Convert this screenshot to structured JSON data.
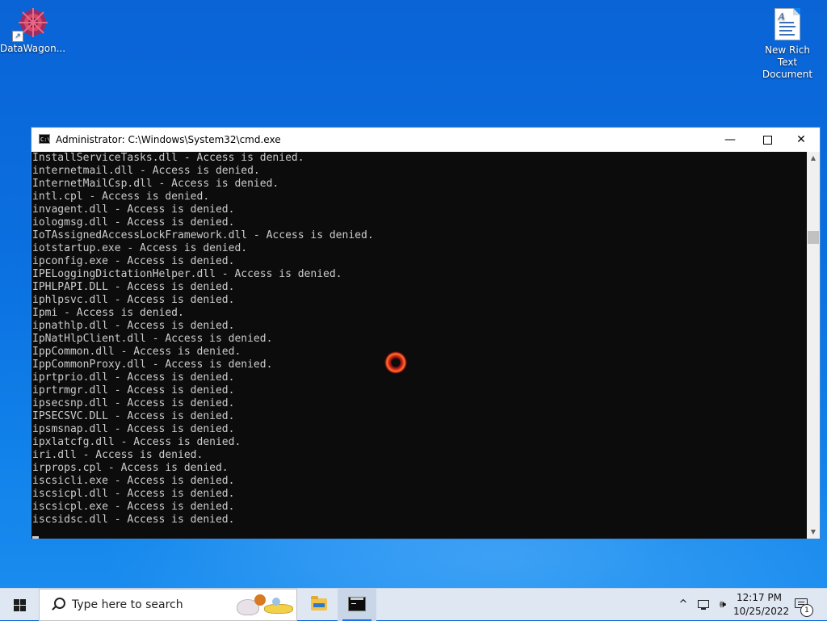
{
  "desktop": {
    "icons": [
      {
        "label": "DataWagon...",
        "icon": "datawagon-app-icon"
      },
      {
        "label": "New Rich Text Document",
        "icon": "rich-text-document-icon"
      }
    ]
  },
  "window": {
    "title": "Administrator:  C:\\Windows\\System32\\cmd.exe",
    "icon": "cmd-icon",
    "controls": {
      "minimize": "—",
      "close": "✕"
    },
    "lines": [
      "InstallServiceTasks.dll - Access is denied.",
      "internetmail.dll - Access is denied.",
      "InternetMailCsp.dll - Access is denied.",
      "intl.cpl - Access is denied.",
      "invagent.dll - Access is denied.",
      "iologmsg.dll - Access is denied.",
      "IoTAssignedAccessLockFramework.dll - Access is denied.",
      "iotstartup.exe - Access is denied.",
      "ipconfig.exe - Access is denied.",
      "IPELoggingDictationHelper.dll - Access is denied.",
      "IPHLPAPI.DLL - Access is denied.",
      "iphlpsvc.dll - Access is denied.",
      "Ipmi - Access is denied.",
      "ipnathlp.dll - Access is denied.",
      "IpNatHlpClient.dll - Access is denied.",
      "IppCommon.dll - Access is denied.",
      "IppCommonProxy.dll - Access is denied.",
      "iprtprio.dll - Access is denied.",
      "iprtrmgr.dll - Access is denied.",
      "ipsecsnp.dll - Access is denied.",
      "IPSECSVC.DLL - Access is denied.",
      "ipsmsnap.dll - Access is denied.",
      "ipxlatcfg.dll - Access is denied.",
      "iri.dll - Access is denied.",
      "irprops.cpl - Access is denied.",
      "iscsicli.exe - Access is denied.",
      "iscsicpl.dll - Access is denied.",
      "iscsicpl.exe - Access is denied.",
      "iscsidsc.dll - Access is denied."
    ]
  },
  "taskbar": {
    "search_placeholder": "Type here to search",
    "chevron": "^",
    "volume": "🕪",
    "time": "12:17 PM",
    "date": "10/25/2022",
    "notification_count": "1",
    "colors": {
      "accent": "#1a73e8",
      "console_bg": "#0c0c0c",
      "console_text": "#cccccc"
    }
  }
}
